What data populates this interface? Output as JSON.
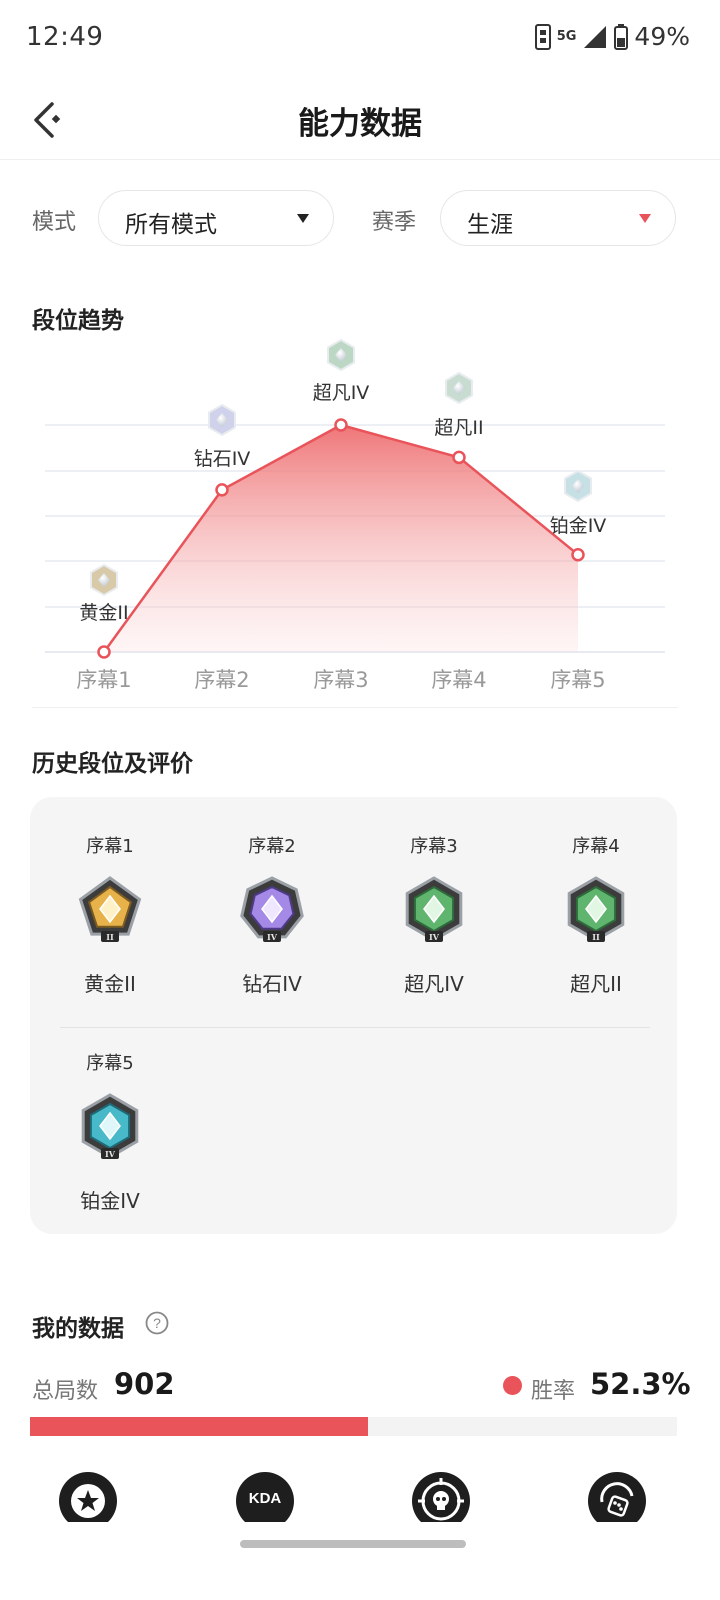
{
  "status_bar": {
    "time": "12:49",
    "network": "5G",
    "battery": "49%"
  },
  "header": {
    "title": "能力数据"
  },
  "filters": {
    "mode_label": "模式",
    "mode_value": "所有模式",
    "season_label": "赛季",
    "season_value": "生涯",
    "season_caret_color": "#e9535a"
  },
  "trend": {
    "title": "段位趋势",
    "chart_data": {
      "type": "area",
      "categories": [
        "序幕1",
        "序幕2",
        "序幕3",
        "序幕4",
        "序幕5"
      ],
      "series": [
        {
          "values": [
            "黄金II",
            "钻石IV",
            "超凡IV",
            "超凡II",
            "铂金IV"
          ]
        }
      ],
      "point_labels": [
        "黄金II",
        "钻石IV",
        "超凡IV",
        "超凡II",
        "铂金IV"
      ],
      "grid": true,
      "color": "#e9535a"
    }
  },
  "history": {
    "title": "历史段位及评价",
    "items": [
      {
        "season": "序幕1",
        "rank": "黄金II",
        "badge": "gold-badge-icon"
      },
      {
        "season": "序幕2",
        "rank": "钻石IV",
        "badge": "diamond-badge-icon"
      },
      {
        "season": "序幕3",
        "rank": "超凡IV",
        "badge": "ascendant-badge-icon"
      },
      {
        "season": "序幕4",
        "rank": "超凡II",
        "badge": "ascendant-badge-icon"
      },
      {
        "season": "序幕5",
        "rank": "铂金IV",
        "badge": "platinum-badge-icon"
      }
    ]
  },
  "my_data": {
    "title": "我的数据",
    "total_label": "总局数",
    "total_value": "902",
    "winrate_label": "胜率",
    "winrate_value": "52.3%",
    "winrate_fraction": 0.523
  },
  "bottom_nav": {
    "items": [
      {
        "icon": "star-shield-icon"
      },
      {
        "icon": "kda-icon",
        "text": "KDA"
      },
      {
        "icon": "skull-target-icon"
      },
      {
        "icon": "dice-icon"
      }
    ]
  }
}
